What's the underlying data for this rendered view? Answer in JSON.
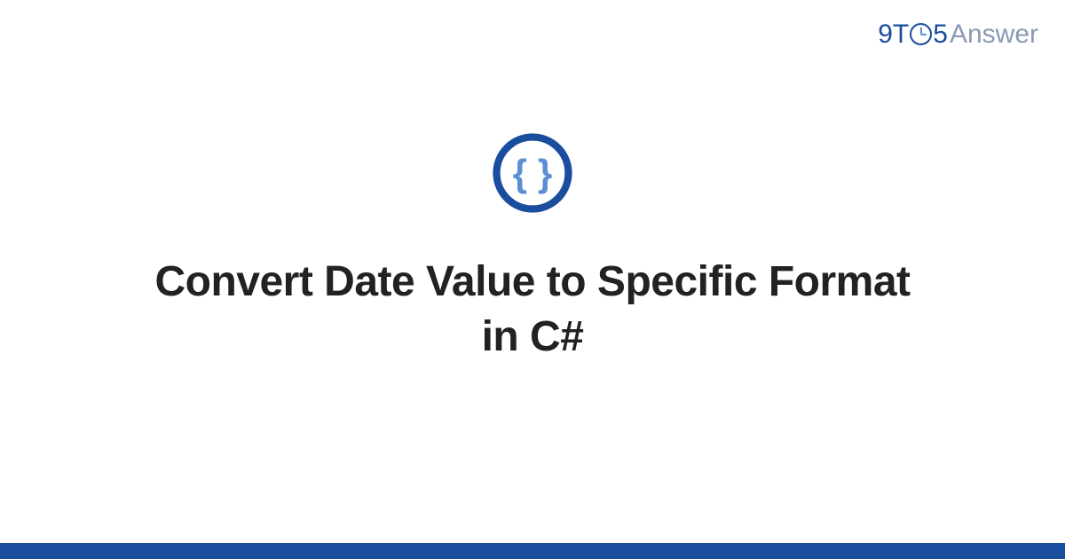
{
  "header": {
    "logo_prefix": "9T",
    "logo_suffix": "5",
    "logo_answer": "Answer"
  },
  "content": {
    "icon_name": "code-braces-icon",
    "title": "Convert Date Value to Specific Format in C#"
  },
  "colors": {
    "brand_primary": "#1a4d9e",
    "brand_secondary": "#8a99b5",
    "icon_inner": "#5b8fd4"
  }
}
